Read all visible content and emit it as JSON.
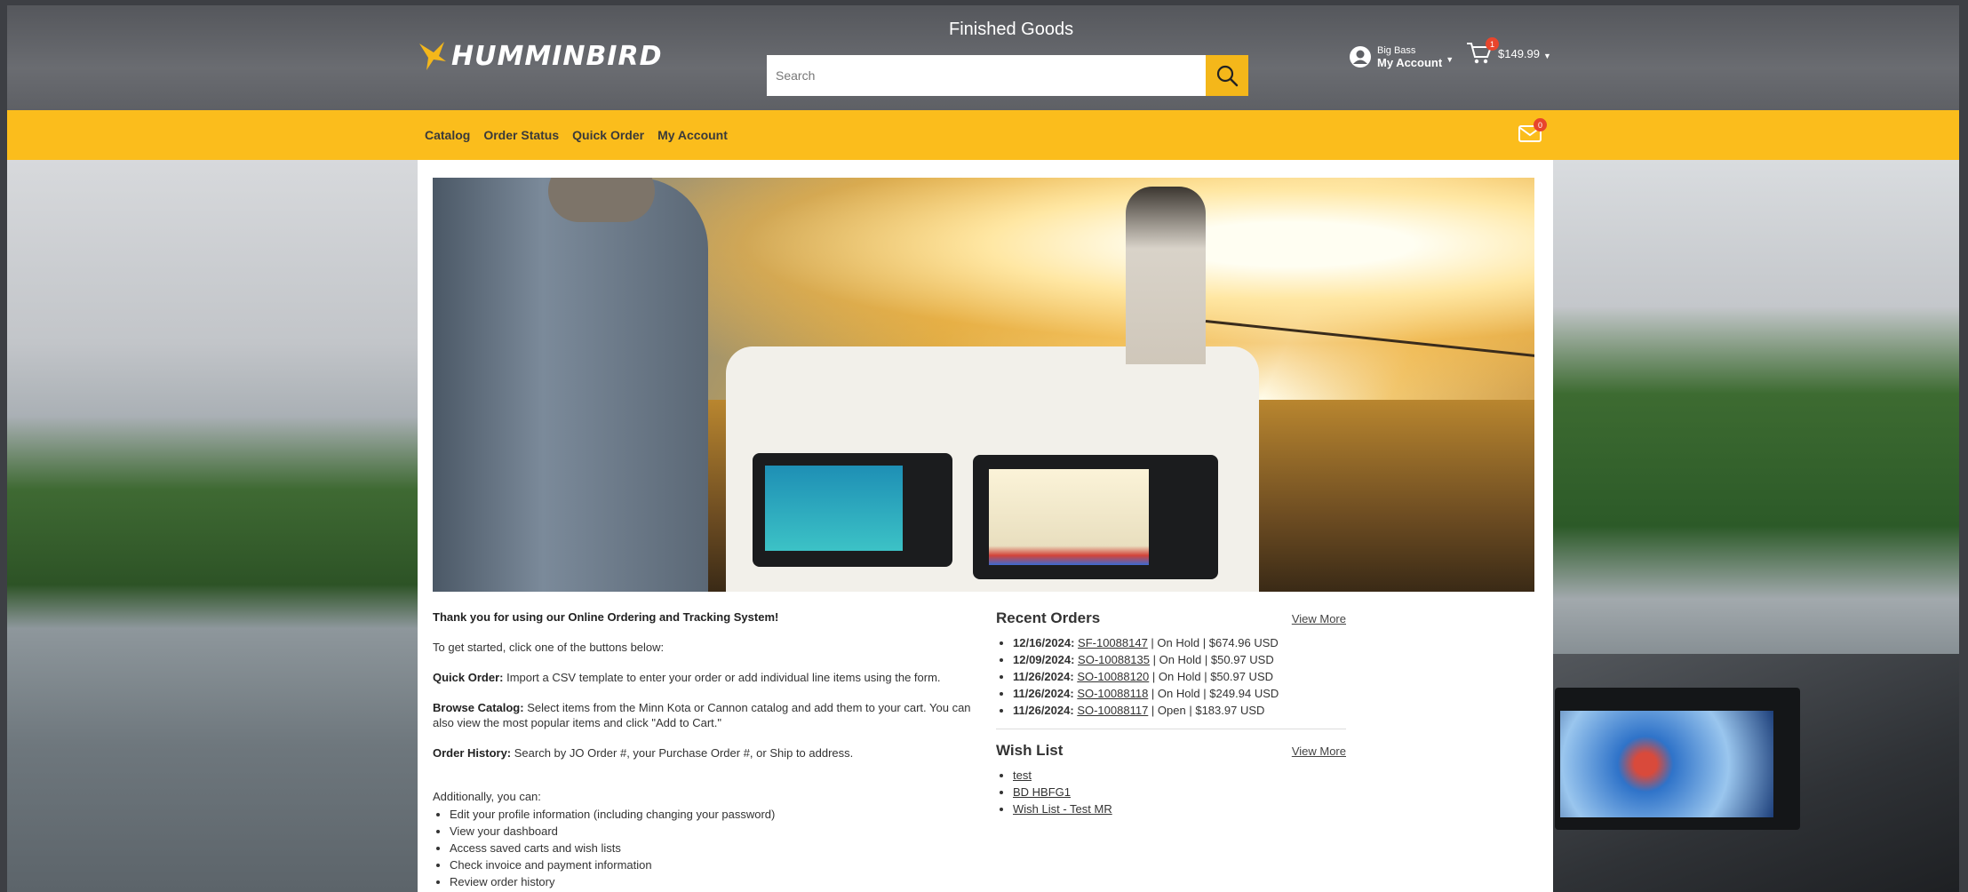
{
  "header": {
    "brand": "HUMMINBIRD",
    "site_title": "Finished Goods",
    "search_placeholder": "Search",
    "account": {
      "name": "Big Bass",
      "label": "My Account"
    },
    "cart": {
      "count": "1",
      "total": "$149.99"
    }
  },
  "nav": {
    "items": [
      "Catalog",
      "Order Status",
      "Quick Order",
      "My Account"
    ],
    "mail_count": "0"
  },
  "intro": {
    "thanks": "Thank you for using our Online Ordering and Tracking System!",
    "get_started": "To get started, click one of the buttons below:",
    "quick_order_label": "Quick Order:",
    "quick_order_text": " Import a CSV template to enter your order or add individual line items using the form.",
    "browse_label": "Browse Catalog:",
    "browse_text": " Select items from the Minn Kota or Cannon catalog and add them to your cart. You can also view the most popular items and click \"Add to Cart.\"",
    "history_label": "Order History:",
    "history_text": " Search by JO Order #, your Purchase Order #, or Ship to address.",
    "additionally": "Additionally, you can:",
    "list": [
      "Edit your profile information (including changing your password)",
      "View your dashboard",
      "Access saved carts and wish lists",
      "Check invoice and payment information",
      "Review order history"
    ]
  },
  "recent_orders": {
    "title": "Recent Orders",
    "view_more": "View More",
    "orders": [
      {
        "date": "12/16/2024:",
        "id": "SF-10088147",
        "status": "On Hold",
        "amount": "$674.96 USD"
      },
      {
        "date": "12/09/2024:",
        "id": "SO-10088135",
        "status": "On Hold",
        "amount": "$50.97 USD"
      },
      {
        "date": "11/26/2024:",
        "id": "SO-10088120",
        "status": "On Hold",
        "amount": "$50.97 USD"
      },
      {
        "date": "11/26/2024:",
        "id": "SO-10088118",
        "status": "On Hold",
        "amount": "$249.94 USD"
      },
      {
        "date": "11/26/2024:",
        "id": "SO-10088117",
        "status": "Open",
        "amount": "$183.97 USD"
      }
    ]
  },
  "wish_list": {
    "title": "Wish List",
    "view_more": "View More",
    "items": [
      "test",
      "BD HBFG1",
      "Wish List - Test MR"
    ]
  },
  "colors": {
    "nav_bg": "#fbbd1c",
    "search_button": "#f4b71a",
    "badge": "#e8452c",
    "header_bg": "#616368"
  }
}
